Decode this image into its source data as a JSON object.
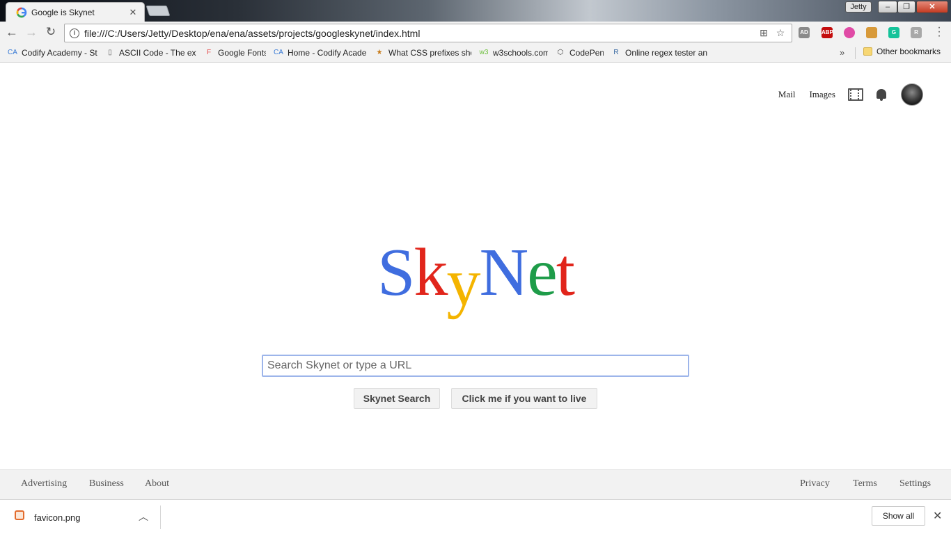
{
  "window": {
    "tab_title": "Google is Skynet",
    "tab_close": "✕",
    "user_badge": "Jetty",
    "min_glyph": "–",
    "max_glyph": "❐",
    "close_glyph": "✕"
  },
  "toolbar": {
    "back_glyph": "←",
    "forward_glyph": "→",
    "reload_glyph": "↻",
    "info_glyph": "i",
    "url": "file:///C:/Users/Jetty/Desktop/ena/ena/assets/projects/googleskynet/index.html",
    "star_glyph": "☆",
    "extensions": [
      {
        "name": "ad-icon",
        "label": "AD",
        "color": "#8a8a8a"
      },
      {
        "name": "adblock-icon",
        "label": "ABP",
        "color": "#c40d0d"
      },
      {
        "name": "color-wheel-icon",
        "label": "",
        "color": "#e04ba6"
      },
      {
        "name": "hammer-icon",
        "label": "",
        "color": "#d89a3a"
      },
      {
        "name": "grammarly-icon",
        "label": "G",
        "color": "#15c39a"
      },
      {
        "name": "readability-icon",
        "label": "R",
        "color": "#a8a8a8"
      }
    ]
  },
  "bookmarks": {
    "items": [
      {
        "icon": "CA",
        "label": "Codify Academy - Stu"
      },
      {
        "icon": "▯",
        "label": "ASCII Code - The exte"
      },
      {
        "icon": "F",
        "label": "Google Fonts"
      },
      {
        "icon": "CA",
        "label": "Home - Codify Acade"
      },
      {
        "icon": "★",
        "label": "What CSS prefixes sho"
      },
      {
        "icon": "w3",
        "label": "w3schools.com"
      },
      {
        "icon": "⬡",
        "label": "CodePen"
      },
      {
        "icon": "R",
        "label": "Online regex tester an"
      }
    ],
    "more_glyph": "»",
    "other_label": "Other bookmarks"
  },
  "page": {
    "nav": {
      "mail": "Mail",
      "images": "Images"
    },
    "logo_letters": [
      {
        "char": "S",
        "color": "#3f6ddf"
      },
      {
        "char": "k",
        "color": "#e1251b"
      },
      {
        "char": "y",
        "color": "#f4b400"
      },
      {
        "char": "N",
        "color": "#3f6ddf"
      },
      {
        "char": "e",
        "color": "#1e9c49"
      },
      {
        "char": "t",
        "color": "#e1251b"
      }
    ],
    "search_placeholder": "Search Skynet or type a URL",
    "search_button": "Skynet Search",
    "live_button": "Click me if you want to live",
    "footer_left": [
      "Advertising",
      "Business",
      "About"
    ],
    "footer_right": [
      "Privacy",
      "Terms",
      "Settings"
    ]
  },
  "downloads": {
    "file_name": "favicon.png",
    "chevron_glyph": "︿",
    "show_all": "Show all",
    "close_glyph": "✕"
  }
}
